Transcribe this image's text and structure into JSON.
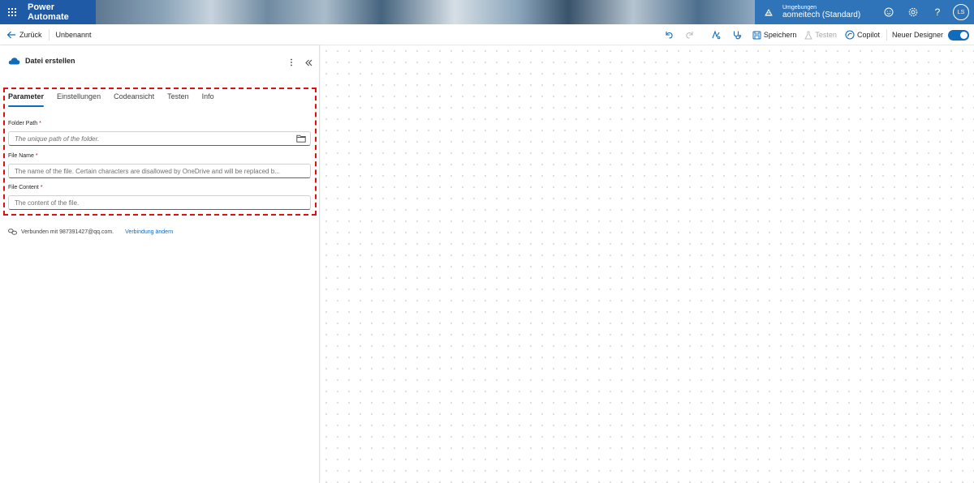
{
  "header": {
    "app_title": "Power Automate",
    "environment_label": "Umgebungen",
    "environment_name": "aomeitech (Standard)",
    "avatar_initials": "LS"
  },
  "commandbar": {
    "back_label": "Zurück",
    "flow_name": "Unbenannt",
    "save_label": "Speichern",
    "test_label": "Testen",
    "copilot_label": "Copilot",
    "new_designer_label": "Neuer Designer",
    "new_designer_enabled": true
  },
  "panel": {
    "title": "Datei erstellen",
    "tabs": [
      {
        "label": "Parameter",
        "active": true
      },
      {
        "label": "Einstellungen",
        "active": false
      },
      {
        "label": "Codeansicht",
        "active": false
      },
      {
        "label": "Testen",
        "active": false
      },
      {
        "label": "Info",
        "active": false
      }
    ],
    "fields": {
      "folder_path": {
        "label": "Folder Path",
        "required_mark": "*",
        "placeholder": "The unique path of the folder."
      },
      "file_name": {
        "label": "File Name",
        "required_mark": "*",
        "placeholder": "The name of the file. Certain characters are disallowed by OneDrive and will be replaced b..."
      },
      "file_content": {
        "label": "File Content",
        "required_mark": "*",
        "placeholder": "The content of the file."
      }
    },
    "connection": {
      "text": "Verbunden mit 987391427@qq.com.",
      "change_link": "Verbindung ändern"
    }
  },
  "colors": {
    "accent": "#0f6cbd",
    "highlight_border": "#e01010"
  }
}
